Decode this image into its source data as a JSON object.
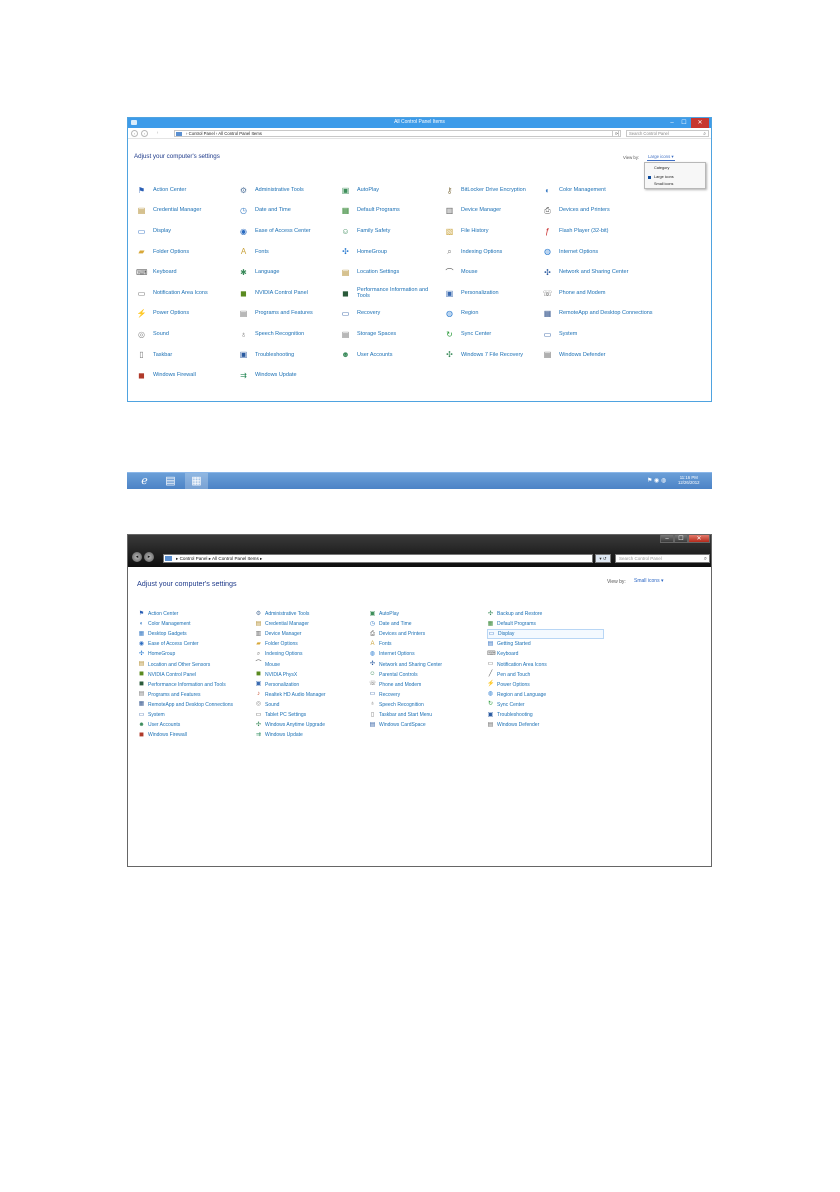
{
  "win8": {
    "title": "All Control Panel Items",
    "controls": {
      "minimize": "–",
      "maximize": "☐",
      "close": "✕"
    },
    "nav": {
      "back": "‹",
      "forward": "›",
      "up": "↑"
    },
    "address": "›  Control Panel  ›  All Control Panel Items",
    "refresh": "⟳",
    "search_placeholder": "Search Control Panel",
    "heading": "Adjust your computer's settings",
    "view_by_label": "View by:",
    "view_by_value": "Large icons ▾",
    "dropdown": [
      "Category",
      "Large icons",
      "Small icons"
    ],
    "items": [
      [
        {
          "label": "Action Center",
          "icon": "flag-icon",
          "glyph": "⚑",
          "color": "#2b5fb5"
        },
        {
          "label": "Administrative Tools",
          "icon": "tools-icon",
          "glyph": "⚙",
          "color": "#5a7aa0"
        },
        {
          "label": "AutoPlay",
          "icon": "autoplay-icon",
          "glyph": "▣",
          "color": "#3f8f5a"
        },
        {
          "label": "BitLocker Drive Encryption",
          "icon": "bitlocker-icon",
          "glyph": "⚷",
          "color": "#8a7a50"
        },
        {
          "label": "Color Management",
          "icon": "color-management-icon",
          "glyph": "◐",
          "color": "#3b7cc4"
        }
      ],
      [
        {
          "label": "Credential Manager",
          "icon": "credential-icon",
          "glyph": "▤",
          "color": "#b08a2a"
        },
        {
          "label": "Date and Time",
          "icon": "clock-icon",
          "glyph": "◷",
          "color": "#3a7dc4"
        },
        {
          "label": "Default Programs",
          "icon": "default-programs-icon",
          "glyph": "▦",
          "color": "#3a8a3a"
        },
        {
          "label": "Device Manager",
          "icon": "device-manager-icon",
          "glyph": "▥",
          "color": "#666"
        },
        {
          "label": "Devices and Printers",
          "icon": "printer-icon",
          "glyph": "⎙",
          "color": "#555"
        }
      ],
      [
        {
          "label": "Display",
          "icon": "display-icon",
          "glyph": "▭",
          "color": "#2a6bc0"
        },
        {
          "label": "Ease of Access Center",
          "icon": "ease-of-access-icon",
          "glyph": "◉",
          "color": "#2a6bc0"
        },
        {
          "label": "Family Safety",
          "icon": "family-safety-icon",
          "glyph": "☺",
          "color": "#3a8a5a"
        },
        {
          "label": "File History",
          "icon": "file-history-icon",
          "glyph": "▧",
          "color": "#c9a23a"
        },
        {
          "label": "Flash Player (32-bit)",
          "icon": "flash-icon",
          "glyph": "ƒ",
          "color": "#c62020"
        }
      ],
      [
        {
          "label": "Folder Options",
          "icon": "folder-icon",
          "glyph": "▰",
          "color": "#d8a83a"
        },
        {
          "label": "Fonts",
          "icon": "fonts-icon",
          "glyph": "A",
          "color": "#c9a23a"
        },
        {
          "label": "HomeGroup",
          "icon": "homegroup-icon",
          "glyph": "✣",
          "color": "#2a7bd0"
        },
        {
          "label": "Indexing Options",
          "icon": "indexing-icon",
          "glyph": "⌕",
          "color": "#777"
        },
        {
          "label": "Internet Options",
          "icon": "internet-options-icon",
          "glyph": "◍",
          "color": "#2a7bd0"
        }
      ],
      [
        {
          "label": "Keyboard",
          "icon": "keyboard-icon",
          "glyph": "⌨",
          "color": "#666"
        },
        {
          "label": "Language",
          "icon": "language-icon",
          "glyph": "✱",
          "color": "#3a8a5a"
        },
        {
          "label": "Location Settings",
          "icon": "location-icon",
          "glyph": "▤",
          "color": "#b08a2a"
        },
        {
          "label": "Mouse",
          "icon": "mouse-icon",
          "glyph": "⌒",
          "color": "#555"
        },
        {
          "label": "Network and Sharing Center",
          "icon": "network-icon",
          "glyph": "✣",
          "color": "#2a5aa0"
        }
      ],
      [
        {
          "label": "Notification Area Icons",
          "icon": "notification-icon",
          "glyph": "▭",
          "color": "#666"
        },
        {
          "label": "NVIDIA Control Panel",
          "icon": "nvidia-icon",
          "glyph": "◼",
          "color": "#5a8a20"
        },
        {
          "label": "Performance Information and Tools",
          "icon": "performance-icon",
          "glyph": "◼",
          "color": "#2a5a3a"
        },
        {
          "label": "Personalization",
          "icon": "personalization-icon",
          "glyph": "▣",
          "color": "#3a6ab0"
        },
        {
          "label": "Phone and Modem",
          "icon": "phone-icon",
          "glyph": "☏",
          "color": "#666"
        }
      ],
      [
        {
          "label": "Power Options",
          "icon": "power-icon",
          "glyph": "⚡",
          "color": "#3a8a3a"
        },
        {
          "label": "Programs and Features",
          "icon": "programs-icon",
          "glyph": "▤",
          "color": "#777"
        },
        {
          "label": "Recovery",
          "icon": "recovery-icon",
          "glyph": "▭",
          "color": "#2a5aa0"
        },
        {
          "label": "Region",
          "icon": "region-icon",
          "glyph": "◍",
          "color": "#2a7bd0"
        },
        {
          "label": "RemoteApp and Desktop Connections",
          "icon": "remoteapp-icon",
          "glyph": "▦",
          "color": "#3a5a90"
        }
      ],
      [
        {
          "label": "Sound",
          "icon": "sound-icon",
          "glyph": "◎",
          "color": "#888"
        },
        {
          "label": "Speech Recognition",
          "icon": "microphone-icon",
          "glyph": "♁",
          "color": "#666"
        },
        {
          "label": "Storage Spaces",
          "icon": "storage-icon",
          "glyph": "▤",
          "color": "#777"
        },
        {
          "label": "Sync Center",
          "icon": "sync-icon",
          "glyph": "↻",
          "color": "#2a9a3a"
        },
        {
          "label": "System",
          "icon": "system-icon",
          "glyph": "▭",
          "color": "#2a5aa0"
        }
      ],
      [
        {
          "label": "Taskbar",
          "icon": "taskbar-icon",
          "glyph": "▯",
          "color": "#777"
        },
        {
          "label": "Troubleshooting",
          "icon": "troubleshooting-icon",
          "glyph": "▣",
          "color": "#2a5aa0"
        },
        {
          "label": "User Accounts",
          "icon": "user-accounts-icon",
          "glyph": "☻",
          "color": "#3a8a5a"
        },
        {
          "label": "Windows 7 File Recovery",
          "icon": "file-recovery-icon",
          "glyph": "✣",
          "color": "#3a8a5a"
        },
        {
          "label": "Windows Defender",
          "icon": "defender-icon",
          "glyph": "▤",
          "color": "#666"
        }
      ],
      [
        {
          "label": "Windows Firewall",
          "icon": "firewall-icon",
          "glyph": "◼",
          "color": "#b03a2a"
        },
        {
          "label": "Windows Update",
          "icon": "windows-update-icon",
          "glyph": "⇉",
          "color": "#2a8a5a"
        }
      ]
    ]
  },
  "taskbar": {
    "buttons": [
      {
        "name": "internet-explorer-icon",
        "glyph": "ℯ"
      },
      {
        "name": "file-explorer-icon",
        "glyph": "▤"
      },
      {
        "name": "control-panel-icon",
        "glyph": "▦"
      }
    ],
    "tray": "⚑ ◉ ◍",
    "time": "11:16 PM",
    "date": "12/26/2012"
  },
  "win7": {
    "controls": {
      "minimize": "–",
      "maximize": "☐",
      "close": "✕"
    },
    "nav": {
      "back": "◂",
      "forward": "▸"
    },
    "address": "▸  Control Panel  ▸  All Control Panel Items  ▸",
    "go": "▾ ↺",
    "search_placeholder": "Search Control Panel",
    "heading": "Adjust your computer's settings",
    "view_by_label": "View by:",
    "view_by_value": "Small icons ▾",
    "columns": [
      [
        {
          "label": "Action Center",
          "icon": "flag-icon",
          "glyph": "⚑",
          "color": "#2b5fb5"
        },
        {
          "label": "Color Management",
          "icon": "color-management-icon",
          "glyph": "◐",
          "color": "#3b7cc4"
        },
        {
          "label": "Desktop Gadgets",
          "icon": "gadgets-icon",
          "glyph": "▦",
          "color": "#3b7cc4"
        },
        {
          "label": "Ease of Access Center",
          "icon": "ease-of-access-icon",
          "glyph": "◉",
          "color": "#2a6bc0"
        },
        {
          "label": "HomeGroup",
          "icon": "homegroup-icon",
          "glyph": "✣",
          "color": "#2a7bd0"
        },
        {
          "label": "Location and Other Sensors",
          "icon": "location-icon",
          "glyph": "▤",
          "color": "#b08a2a"
        },
        {
          "label": "NVIDIA Control Panel",
          "icon": "nvidia-icon",
          "glyph": "◼",
          "color": "#5a8a20"
        },
        {
          "label": "Performance Information and Tools",
          "icon": "performance-icon",
          "glyph": "◼",
          "color": "#2a5a3a"
        },
        {
          "label": "Programs and Features",
          "icon": "programs-icon",
          "glyph": "▤",
          "color": "#777"
        },
        {
          "label": "RemoteApp and Desktop Connections",
          "icon": "remoteapp-icon",
          "glyph": "▦",
          "color": "#3a5a90"
        },
        {
          "label": "System",
          "icon": "system-icon",
          "glyph": "▭",
          "color": "#2a5aa0"
        },
        {
          "label": "User Accounts",
          "icon": "user-accounts-icon",
          "glyph": "☻",
          "color": "#3a8a5a"
        },
        {
          "label": "Windows Firewall",
          "icon": "firewall-icon",
          "glyph": "◼",
          "color": "#b03a2a"
        }
      ],
      [
        {
          "label": "Administrative Tools",
          "icon": "tools-icon",
          "glyph": "⚙",
          "color": "#5a7aa0"
        },
        {
          "label": "Credential Manager",
          "icon": "credential-icon",
          "glyph": "▤",
          "color": "#b08a2a"
        },
        {
          "label": "Device Manager",
          "icon": "device-manager-icon",
          "glyph": "▥",
          "color": "#666"
        },
        {
          "label": "Folder Options",
          "icon": "folder-icon",
          "glyph": "▰",
          "color": "#d8a83a"
        },
        {
          "label": "Indexing Options",
          "icon": "indexing-icon",
          "glyph": "⌕",
          "color": "#777"
        },
        {
          "label": "Mouse",
          "icon": "mouse-icon",
          "glyph": "⌒",
          "color": "#555"
        },
        {
          "label": "NVIDIA PhysX",
          "icon": "physx-icon",
          "glyph": "◼",
          "color": "#5a8a20"
        },
        {
          "label": "Personalization",
          "icon": "personalization-icon",
          "glyph": "▣",
          "color": "#3a6ab0"
        },
        {
          "label": "Realtek HD Audio Manager",
          "icon": "audio-manager-icon",
          "glyph": "♪",
          "color": "#c04020"
        },
        {
          "label": "Sound",
          "icon": "sound-icon",
          "glyph": "◎",
          "color": "#888"
        },
        {
          "label": "Tablet PC Settings",
          "icon": "tablet-icon",
          "glyph": "▭",
          "color": "#555"
        },
        {
          "label": "Windows Anytime Upgrade",
          "icon": "upgrade-icon",
          "glyph": "✣",
          "color": "#3a8a5a"
        },
        {
          "label": "Windows Update",
          "icon": "windows-update-icon",
          "glyph": "⇉",
          "color": "#2a8a5a"
        }
      ],
      [
        {
          "label": "AutoPlay",
          "icon": "autoplay-icon",
          "glyph": "▣",
          "color": "#3f8f5a"
        },
        {
          "label": "Date and Time",
          "icon": "clock-icon",
          "glyph": "◷",
          "color": "#3a7dc4"
        },
        {
          "label": "Devices and Printers",
          "icon": "printer-icon",
          "glyph": "⎙",
          "color": "#555"
        },
        {
          "label": "Fonts",
          "icon": "fonts-icon",
          "glyph": "A",
          "color": "#c9a23a"
        },
        {
          "label": "Internet Options",
          "icon": "internet-options-icon",
          "glyph": "◍",
          "color": "#2a7bd0"
        },
        {
          "label": "Network and Sharing Center",
          "icon": "network-icon",
          "glyph": "✣",
          "color": "#2a5aa0"
        },
        {
          "label": "Parental Controls",
          "icon": "parental-controls-icon",
          "glyph": "☺",
          "color": "#3a8a5a"
        },
        {
          "label": "Phone and Modem",
          "icon": "phone-icon",
          "glyph": "☏",
          "color": "#666"
        },
        {
          "label": "Recovery",
          "icon": "recovery-icon",
          "glyph": "▭",
          "color": "#2a5aa0"
        },
        {
          "label": "Speech Recognition",
          "icon": "microphone-icon",
          "glyph": "♁",
          "color": "#666"
        },
        {
          "label": "Taskbar and Start Menu",
          "icon": "taskbar-icon",
          "glyph": "▯",
          "color": "#777"
        },
        {
          "label": "Windows CardSpace",
          "icon": "cardspace-icon",
          "glyph": "▤",
          "color": "#2a5aa0"
        }
      ],
      [
        {
          "label": "Backup and Restore",
          "icon": "backup-icon",
          "glyph": "✣",
          "color": "#3a8a5a"
        },
        {
          "label": "Default Programs",
          "icon": "default-programs-icon",
          "glyph": "▦",
          "color": "#3a8a3a"
        },
        {
          "label": "Display",
          "icon": "display-icon",
          "glyph": "▭",
          "color": "#2a6bc0"
        },
        {
          "label": "Getting Started",
          "icon": "getting-started-icon",
          "glyph": "▤",
          "color": "#2a6bc0"
        },
        {
          "label": "Keyboard",
          "icon": "keyboard-icon",
          "glyph": "⌨",
          "color": "#666"
        },
        {
          "label": "Notification Area Icons",
          "icon": "notification-icon",
          "glyph": "▭",
          "color": "#666"
        },
        {
          "label": "Pen and Touch",
          "icon": "pen-icon",
          "glyph": "╱",
          "color": "#555"
        },
        {
          "label": "Power Options",
          "icon": "power-icon",
          "glyph": "⚡",
          "color": "#3a8a3a"
        },
        {
          "label": "Region and Language",
          "icon": "region-icon",
          "glyph": "◍",
          "color": "#2a7bd0"
        },
        {
          "label": "Sync Center",
          "icon": "sync-icon",
          "glyph": "↻",
          "color": "#2a9a3a"
        },
        {
          "label": "Troubleshooting",
          "icon": "troubleshooting-icon",
          "glyph": "▣",
          "color": "#2a5aa0"
        },
        {
          "label": "Windows Defender",
          "icon": "defender-icon",
          "glyph": "▤",
          "color": "#666"
        }
      ]
    ]
  }
}
